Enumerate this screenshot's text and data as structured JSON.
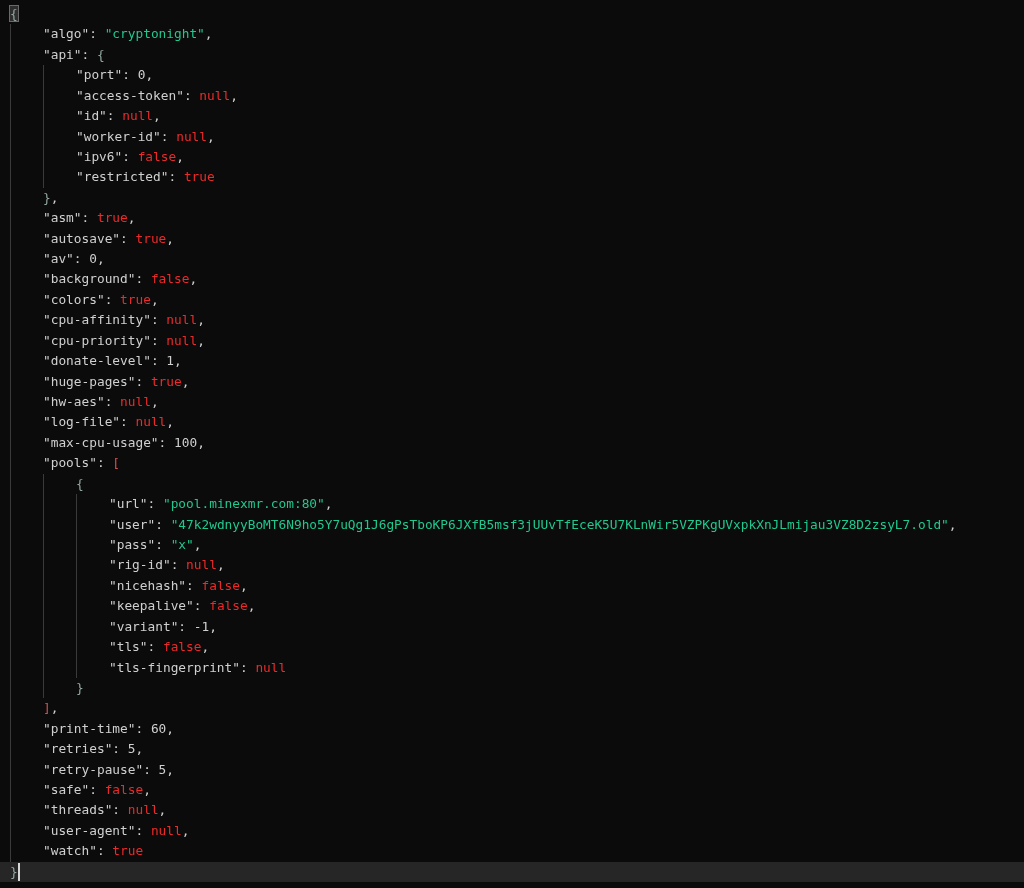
{
  "editor": {
    "lines": [
      {
        "tokens": [
          {
            "kind": "brace",
            "text": "{",
            "matched": true
          }
        ],
        "children": [
          {
            "tokens": [
              {
                "kind": "key",
                "text": "\"algo\""
              },
              {
                "kind": "punct",
                "text": ": "
              },
              {
                "kind": "str",
                "text": "\"cryptonight\""
              },
              {
                "kind": "punct",
                "text": ","
              }
            ]
          },
          {
            "tokens": [
              {
                "kind": "key",
                "text": "\"api\""
              },
              {
                "kind": "punct",
                "text": ": "
              },
              {
                "kind": "brace",
                "text": "{"
              }
            ],
            "children": [
              {
                "tokens": [
                  {
                    "kind": "key",
                    "text": "\"port\""
                  },
                  {
                    "kind": "punct",
                    "text": ": "
                  },
                  {
                    "kind": "num",
                    "text": "0"
                  },
                  {
                    "kind": "punct",
                    "text": ","
                  }
                ]
              },
              {
                "tokens": [
                  {
                    "kind": "key",
                    "text": "\"access-token\""
                  },
                  {
                    "kind": "punct",
                    "text": ": "
                  },
                  {
                    "kind": "lit",
                    "text": "null"
                  },
                  {
                    "kind": "punct",
                    "text": ","
                  }
                ]
              },
              {
                "tokens": [
                  {
                    "kind": "key",
                    "text": "\"id\""
                  },
                  {
                    "kind": "punct",
                    "text": ": "
                  },
                  {
                    "kind": "lit",
                    "text": "null"
                  },
                  {
                    "kind": "punct",
                    "text": ","
                  }
                ]
              },
              {
                "tokens": [
                  {
                    "kind": "key",
                    "text": "\"worker-id\""
                  },
                  {
                    "kind": "punct",
                    "text": ": "
                  },
                  {
                    "kind": "lit",
                    "text": "null"
                  },
                  {
                    "kind": "punct",
                    "text": ","
                  }
                ]
              },
              {
                "tokens": [
                  {
                    "kind": "key",
                    "text": "\"ipv6\""
                  },
                  {
                    "kind": "punct",
                    "text": ": "
                  },
                  {
                    "kind": "lit",
                    "text": "false"
                  },
                  {
                    "kind": "punct",
                    "text": ","
                  }
                ]
              },
              {
                "tokens": [
                  {
                    "kind": "key",
                    "text": "\"restricted\""
                  },
                  {
                    "kind": "punct",
                    "text": ": "
                  },
                  {
                    "kind": "lit",
                    "text": "true"
                  }
                ]
              }
            ]
          },
          {
            "tokens": [
              {
                "kind": "brace",
                "text": "}"
              },
              {
                "kind": "punct",
                "text": ","
              }
            ]
          },
          {
            "tokens": [
              {
                "kind": "key",
                "text": "\"asm\""
              },
              {
                "kind": "punct",
                "text": ": "
              },
              {
                "kind": "lit",
                "text": "true"
              },
              {
                "kind": "punct",
                "text": ","
              }
            ]
          },
          {
            "tokens": [
              {
                "kind": "key",
                "text": "\"autosave\""
              },
              {
                "kind": "punct",
                "text": ": "
              },
              {
                "kind": "lit",
                "text": "true"
              },
              {
                "kind": "punct",
                "text": ","
              }
            ]
          },
          {
            "tokens": [
              {
                "kind": "key",
                "text": "\"av\""
              },
              {
                "kind": "punct",
                "text": ": "
              },
              {
                "kind": "num",
                "text": "0"
              },
              {
                "kind": "punct",
                "text": ","
              }
            ]
          },
          {
            "tokens": [
              {
                "kind": "key",
                "text": "\"background\""
              },
              {
                "kind": "punct",
                "text": ": "
              },
              {
                "kind": "lit",
                "text": "false"
              },
              {
                "kind": "punct",
                "text": ","
              }
            ]
          },
          {
            "tokens": [
              {
                "kind": "key",
                "text": "\"colors\""
              },
              {
                "kind": "punct",
                "text": ": "
              },
              {
                "kind": "lit",
                "text": "true"
              },
              {
                "kind": "punct",
                "text": ","
              }
            ]
          },
          {
            "tokens": [
              {
                "kind": "key",
                "text": "\"cpu-affinity\""
              },
              {
                "kind": "punct",
                "text": ": "
              },
              {
                "kind": "lit",
                "text": "null"
              },
              {
                "kind": "punct",
                "text": ","
              }
            ]
          },
          {
            "tokens": [
              {
                "kind": "key",
                "text": "\"cpu-priority\""
              },
              {
                "kind": "punct",
                "text": ": "
              },
              {
                "kind": "lit",
                "text": "null"
              },
              {
                "kind": "punct",
                "text": ","
              }
            ]
          },
          {
            "tokens": [
              {
                "kind": "key",
                "text": "\"donate-level\""
              },
              {
                "kind": "punct",
                "text": ": "
              },
              {
                "kind": "num",
                "text": "1"
              },
              {
                "kind": "punct",
                "text": ","
              }
            ]
          },
          {
            "tokens": [
              {
                "kind": "key",
                "text": "\"huge-pages\""
              },
              {
                "kind": "punct",
                "text": ": "
              },
              {
                "kind": "lit",
                "text": "true"
              },
              {
                "kind": "punct",
                "text": ","
              }
            ]
          },
          {
            "tokens": [
              {
                "kind": "key",
                "text": "\"hw-aes\""
              },
              {
                "kind": "punct",
                "text": ": "
              },
              {
                "kind": "lit",
                "text": "null"
              },
              {
                "kind": "punct",
                "text": ","
              }
            ]
          },
          {
            "tokens": [
              {
                "kind": "key",
                "text": "\"log-file\""
              },
              {
                "kind": "punct",
                "text": ": "
              },
              {
                "kind": "lit",
                "text": "null"
              },
              {
                "kind": "punct",
                "text": ","
              }
            ]
          },
          {
            "tokens": [
              {
                "kind": "key",
                "text": "\"max-cpu-usage\""
              },
              {
                "kind": "punct",
                "text": ": "
              },
              {
                "kind": "num",
                "text": "100"
              },
              {
                "kind": "punct",
                "text": ","
              }
            ]
          },
          {
            "tokens": [
              {
                "kind": "key",
                "text": "\"pools\""
              },
              {
                "kind": "punct",
                "text": ": "
              },
              {
                "kind": "bracket",
                "text": "["
              }
            ],
            "children": [
              {
                "tokens": [
                  {
                    "kind": "brace",
                    "text": "{"
                  }
                ],
                "children": [
                  {
                    "tokens": [
                      {
                        "kind": "key",
                        "text": "\"url\""
                      },
                      {
                        "kind": "punct",
                        "text": ": "
                      },
                      {
                        "kind": "str",
                        "text": "\"pool.minexmr.com:80\""
                      },
                      {
                        "kind": "punct",
                        "text": ","
                      }
                    ]
                  },
                  {
                    "tokens": [
                      {
                        "kind": "key",
                        "text": "\"user\""
                      },
                      {
                        "kind": "punct",
                        "text": ": "
                      },
                      {
                        "kind": "str",
                        "text": "\"47k2wdnyyBoMT6N9ho5Y7uQg1J6gPsTboKP6JXfB5msf3jUUvTfEceK5U7KLnWir5VZPKgUVxpkXnJLmijau3VZ8D2zsyL7.old\""
                      },
                      {
                        "kind": "punct",
                        "text": ","
                      }
                    ]
                  },
                  {
                    "tokens": [
                      {
                        "kind": "key",
                        "text": "\"pass\""
                      },
                      {
                        "kind": "punct",
                        "text": ": "
                      },
                      {
                        "kind": "str",
                        "text": "\"x\""
                      },
                      {
                        "kind": "punct",
                        "text": ","
                      }
                    ]
                  },
                  {
                    "tokens": [
                      {
                        "kind": "key",
                        "text": "\"rig-id\""
                      },
                      {
                        "kind": "punct",
                        "text": ": "
                      },
                      {
                        "kind": "lit",
                        "text": "null"
                      },
                      {
                        "kind": "punct",
                        "text": ","
                      }
                    ]
                  },
                  {
                    "tokens": [
                      {
                        "kind": "key",
                        "text": "\"nicehash\""
                      },
                      {
                        "kind": "punct",
                        "text": ": "
                      },
                      {
                        "kind": "lit",
                        "text": "false"
                      },
                      {
                        "kind": "punct",
                        "text": ","
                      }
                    ]
                  },
                  {
                    "tokens": [
                      {
                        "kind": "key",
                        "text": "\"keepalive\""
                      },
                      {
                        "kind": "punct",
                        "text": ": "
                      },
                      {
                        "kind": "lit",
                        "text": "false"
                      },
                      {
                        "kind": "punct",
                        "text": ","
                      }
                    ]
                  },
                  {
                    "tokens": [
                      {
                        "kind": "key",
                        "text": "\"variant\""
                      },
                      {
                        "kind": "punct",
                        "text": ": "
                      },
                      {
                        "kind": "num",
                        "text": "-1"
                      },
                      {
                        "kind": "punct",
                        "text": ","
                      }
                    ]
                  },
                  {
                    "tokens": [
                      {
                        "kind": "key",
                        "text": "\"tls\""
                      },
                      {
                        "kind": "punct",
                        "text": ": "
                      },
                      {
                        "kind": "lit",
                        "text": "false"
                      },
                      {
                        "kind": "punct",
                        "text": ","
                      }
                    ]
                  },
                  {
                    "tokens": [
                      {
                        "kind": "key",
                        "text": "\"tls-fingerprint\""
                      },
                      {
                        "kind": "punct",
                        "text": ": "
                      },
                      {
                        "kind": "lit",
                        "text": "null"
                      }
                    ]
                  }
                ]
              },
              {
                "tokens": [
                  {
                    "kind": "brace",
                    "text": "}"
                  }
                ]
              }
            ]
          },
          {
            "tokens": [
              {
                "kind": "bracket",
                "text": "]"
              },
              {
                "kind": "punct",
                "text": ","
              }
            ]
          },
          {
            "tokens": [
              {
                "kind": "key",
                "text": "\"print-time\""
              },
              {
                "kind": "punct",
                "text": ": "
              },
              {
                "kind": "num",
                "text": "60"
              },
              {
                "kind": "punct",
                "text": ","
              }
            ]
          },
          {
            "tokens": [
              {
                "kind": "key",
                "text": "\"retries\""
              },
              {
                "kind": "punct",
                "text": ": "
              },
              {
                "kind": "num",
                "text": "5"
              },
              {
                "kind": "punct",
                "text": ","
              }
            ]
          },
          {
            "tokens": [
              {
                "kind": "key",
                "text": "\"retry-pause\""
              },
              {
                "kind": "punct",
                "text": ": "
              },
              {
                "kind": "num",
                "text": "5"
              },
              {
                "kind": "punct",
                "text": ","
              }
            ]
          },
          {
            "tokens": [
              {
                "kind": "key",
                "text": "\"safe\""
              },
              {
                "kind": "punct",
                "text": ": "
              },
              {
                "kind": "lit",
                "text": "false"
              },
              {
                "kind": "punct",
                "text": ","
              }
            ]
          },
          {
            "tokens": [
              {
                "kind": "key",
                "text": "\"threads\""
              },
              {
                "kind": "punct",
                "text": ": "
              },
              {
                "kind": "lit",
                "text": "null"
              },
              {
                "kind": "punct",
                "text": ","
              }
            ]
          },
          {
            "tokens": [
              {
                "kind": "key",
                "text": "\"user-agent\""
              },
              {
                "kind": "punct",
                "text": ": "
              },
              {
                "kind": "lit",
                "text": "null"
              },
              {
                "kind": "punct",
                "text": ","
              }
            ]
          },
          {
            "tokens": [
              {
                "kind": "key",
                "text": "\"watch\""
              },
              {
                "kind": "punct",
                "text": ": "
              },
              {
                "kind": "lit",
                "text": "true"
              }
            ]
          }
        ]
      },
      {
        "tokens": [
          {
            "kind": "brace",
            "text": "}"
          }
        ],
        "current": true
      }
    ]
  }
}
